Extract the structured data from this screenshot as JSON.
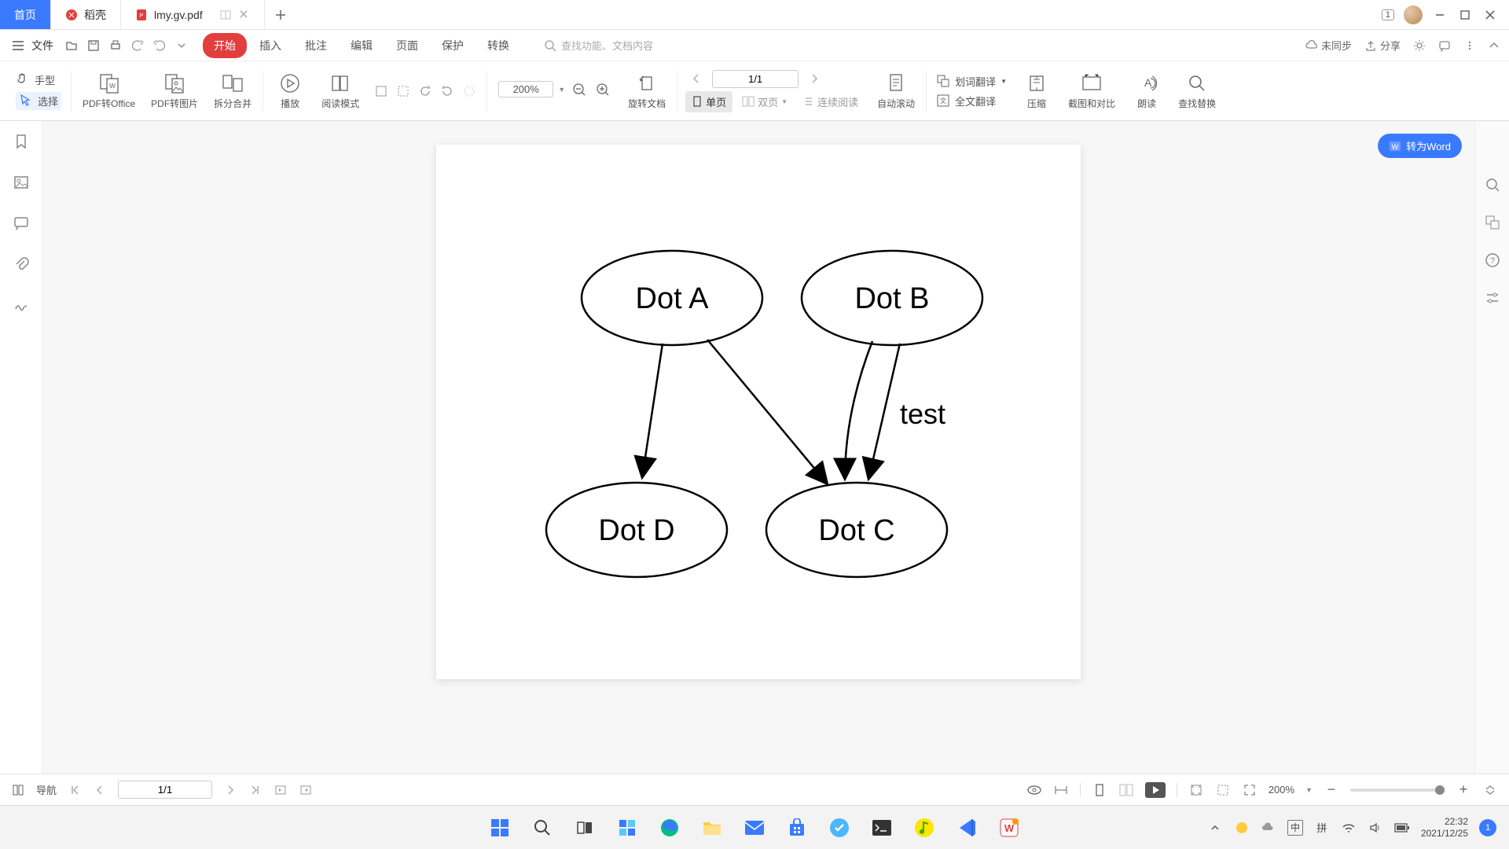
{
  "tabs": {
    "home": "首页",
    "daoke": "稻壳",
    "file": "lmy.gv.pdf"
  },
  "win": {
    "badge": "1"
  },
  "menubar": {
    "file": "文件",
    "items": [
      "开始",
      "插入",
      "批注",
      "编辑",
      "页面",
      "保护",
      "转换"
    ],
    "search_placeholder": "查找功能、文档内容",
    "sync": "未同步",
    "share": "分享"
  },
  "ribbon": {
    "hand": "手型",
    "select": "选择",
    "pdf_to_office": "PDF转Office",
    "pdf_to_image": "PDF转图片",
    "split_merge": "拆分合并",
    "play": "播放",
    "read_mode": "阅读模式",
    "rotate_doc": "旋转文档",
    "single_page": "单页",
    "double_page": "双页",
    "continuous": "连续阅读",
    "auto_scroll": "自动滚动",
    "word_translate": "划词翻译",
    "full_translate": "全文翻译",
    "compress": "压缩",
    "screenshot_compare": "截图和对比",
    "read_aloud": "朗读",
    "find_replace": "查找替换",
    "zoom_value": "200%",
    "page_value": "1/1"
  },
  "to_word": "转为Word",
  "statusbar": {
    "nav": "导航",
    "page": "1/1",
    "zoom": "200%"
  },
  "taskbar": {
    "time": "22:32",
    "date": "2021/12/25",
    "ime": "中",
    "ime2": "拼",
    "noti_count": "1"
  },
  "document": {
    "nodes": {
      "a": "Dot A",
      "b": "Dot B",
      "c": "Dot C",
      "d": "Dot D"
    },
    "edge_label": "test"
  },
  "chart_data": {
    "type": "diagram",
    "nodes": [
      "Dot A",
      "Dot B",
      "Dot C",
      "Dot D"
    ],
    "edges": [
      {
        "from": "Dot A",
        "to": "Dot D"
      },
      {
        "from": "Dot A",
        "to": "Dot C"
      },
      {
        "from": "Dot B",
        "to": "Dot C"
      },
      {
        "from": "Dot B",
        "to": "Dot C",
        "label": "test"
      }
    ]
  }
}
